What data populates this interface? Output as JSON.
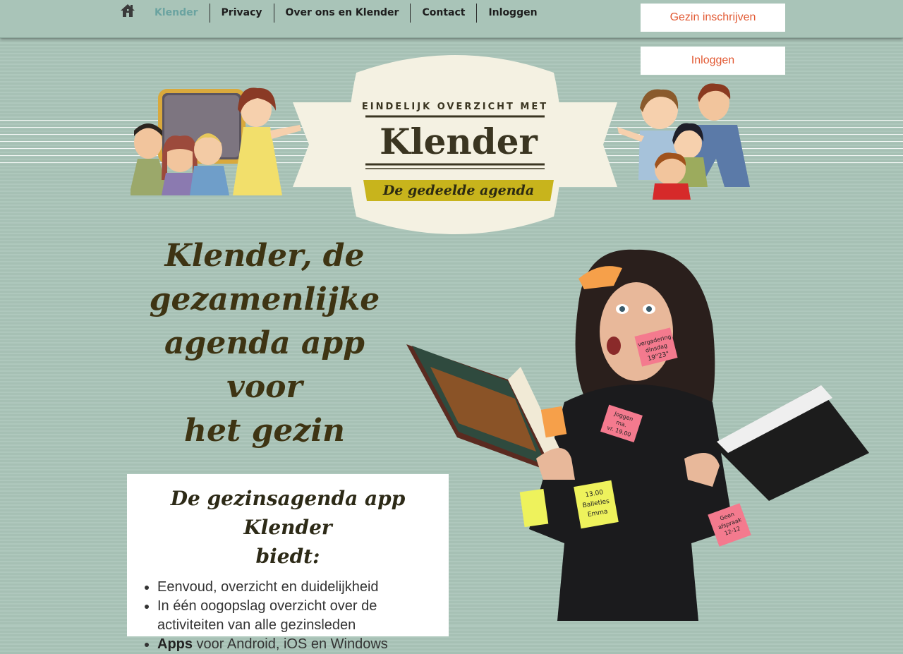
{
  "nav": {
    "home_icon": "home-icon",
    "items": [
      "Klender",
      "Privacy",
      "Over ons en Klender",
      "Contact",
      "Inloggen"
    ]
  },
  "buttons": {
    "register": "Gezin inschrijven",
    "login": "Inloggen"
  },
  "logo": {
    "tagline_top": "EINDELIJK OVERZICHT MET",
    "name": "Klender",
    "subtitle": "De gedeelde agenda"
  },
  "hero": {
    "title_lines": [
      "Klender, de",
      "gezamenlijke",
      "agenda app voor",
      "het gezin"
    ]
  },
  "card": {
    "title_lines": [
      "De gezinsagenda app Klender",
      "biedt:"
    ],
    "features": [
      "Eenvoud, overzicht en duidelijkheid",
      "In één oogopslag overzicht over de activiteiten van alle gezinsleden"
    ],
    "apps_bold": "Apps",
    "apps_rest": " voor Android, iOS en Windows"
  },
  "sticky_notes": {
    "cheek": [
      "vergadering",
      "dinsdag",
      "19\"23\""
    ],
    "chest": [
      "Joggen",
      "ma.",
      "vr. 19.00"
    ],
    "center": [
      "13.00",
      "Balletles",
      "Emma"
    ],
    "right": [
      "Geen",
      "afspraak",
      "12-12"
    ]
  },
  "colors": {
    "background": "#a9c4b8",
    "nav_active": "#6aa3a0",
    "button_text": "#e25a34",
    "title_text": "#3e3413",
    "logo_ribbon": "#c8b41c"
  }
}
